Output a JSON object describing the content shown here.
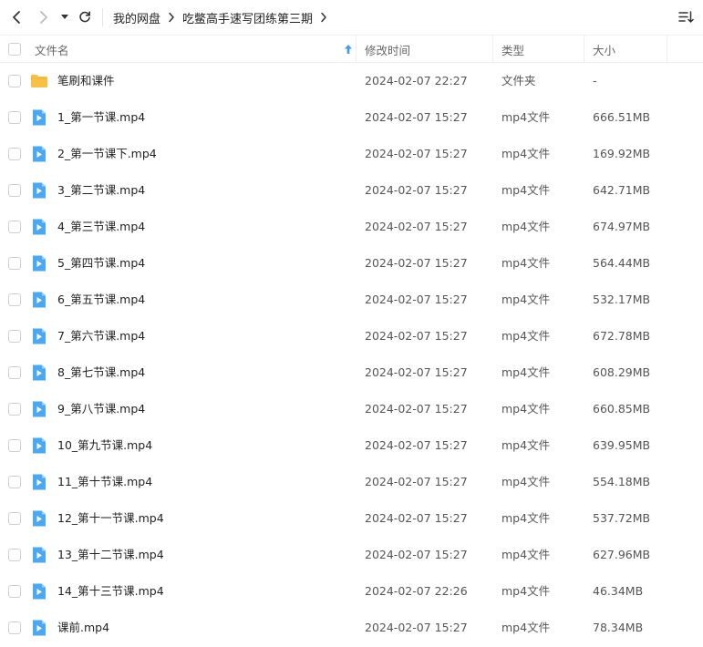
{
  "breadcrumb": [
    "我的网盘",
    "吃鳖高手速写团练第三期"
  ],
  "columns": {
    "name": "文件名",
    "modified": "修改时间",
    "type": "类型",
    "size": "大小"
  },
  "colors": {
    "folder": "#f8c045",
    "video": "#4aa8f5",
    "sort_arrow": "#3a9cf2"
  },
  "files": [
    {
      "name": "笔刷和课件",
      "modified": "2024-02-07 22:27",
      "type": "文件夹",
      "size": "-",
      "icon": "folder-icon"
    },
    {
      "name": "1_第一节课.mp4",
      "modified": "2024-02-07 15:27",
      "type": "mp4文件",
      "size": "666.51MB",
      "icon": "video-file-icon"
    },
    {
      "name": "2_第一节课下.mp4",
      "modified": "2024-02-07 15:27",
      "type": "mp4文件",
      "size": "169.92MB",
      "icon": "video-file-icon"
    },
    {
      "name": "3_第二节课.mp4",
      "modified": "2024-02-07 15:27",
      "type": "mp4文件",
      "size": "642.71MB",
      "icon": "video-file-icon"
    },
    {
      "name": "4_第三节课.mp4",
      "modified": "2024-02-07 15:27",
      "type": "mp4文件",
      "size": "674.97MB",
      "icon": "video-file-icon"
    },
    {
      "name": "5_第四节课.mp4",
      "modified": "2024-02-07 15:27",
      "type": "mp4文件",
      "size": "564.44MB",
      "icon": "video-file-icon"
    },
    {
      "name": "6_第五节课.mp4",
      "modified": "2024-02-07 15:27",
      "type": "mp4文件",
      "size": "532.17MB",
      "icon": "video-file-icon"
    },
    {
      "name": "7_第六节课.mp4",
      "modified": "2024-02-07 15:27",
      "type": "mp4文件",
      "size": "672.78MB",
      "icon": "video-file-icon"
    },
    {
      "name": "8_第七节课.mp4",
      "modified": "2024-02-07 15:27",
      "type": "mp4文件",
      "size": "608.29MB",
      "icon": "video-file-icon"
    },
    {
      "name": "9_第八节课.mp4",
      "modified": "2024-02-07 15:27",
      "type": "mp4文件",
      "size": "660.85MB",
      "icon": "video-file-icon"
    },
    {
      "name": "10_第九节课.mp4",
      "modified": "2024-02-07 15:27",
      "type": "mp4文件",
      "size": "639.95MB",
      "icon": "video-file-icon"
    },
    {
      "name": "11_第十节课.mp4",
      "modified": "2024-02-07 15:27",
      "type": "mp4文件",
      "size": "554.18MB",
      "icon": "video-file-icon"
    },
    {
      "name": "12_第十一节课.mp4",
      "modified": "2024-02-07 15:27",
      "type": "mp4文件",
      "size": "537.72MB",
      "icon": "video-file-icon"
    },
    {
      "name": "13_第十二节课.mp4",
      "modified": "2024-02-07 15:27",
      "type": "mp4文件",
      "size": "627.96MB",
      "icon": "video-file-icon"
    },
    {
      "name": "14_第十三节课.mp4",
      "modified": "2024-02-07 22:26",
      "type": "mp4文件",
      "size": "46.34MB",
      "icon": "video-file-icon"
    },
    {
      "name": "课前.mp4",
      "modified": "2024-02-07 15:27",
      "type": "mp4文件",
      "size": "78.34MB",
      "icon": "video-file-icon"
    }
  ]
}
